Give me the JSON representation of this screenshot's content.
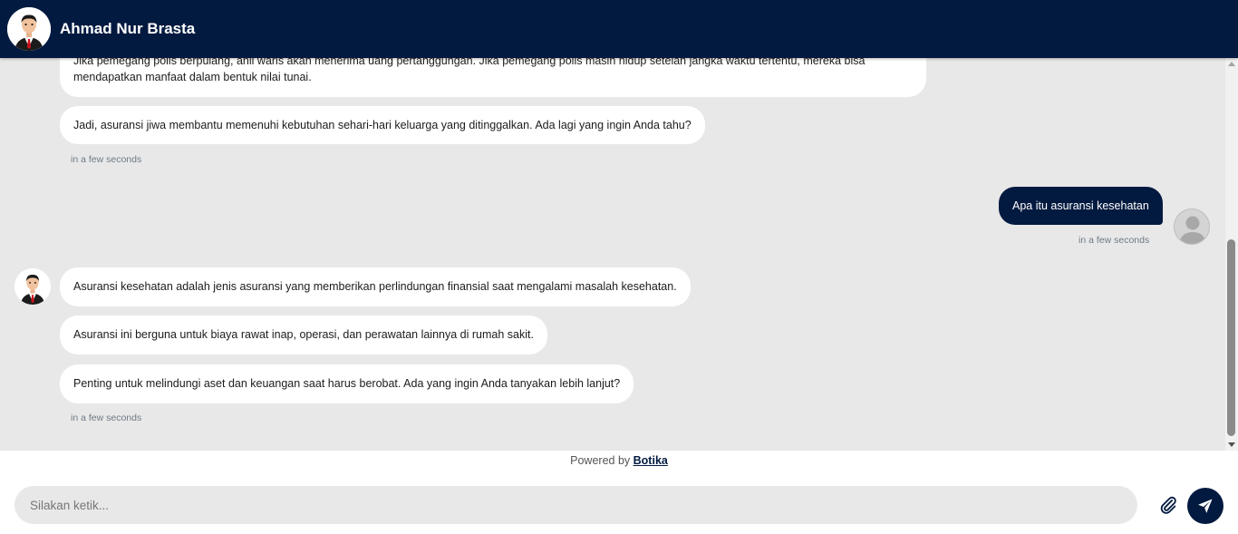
{
  "header": {
    "title": "Ahmad Nur Brasta",
    "avatar_icon": "businessman-avatar-icon"
  },
  "messages": {
    "bot_group_1": {
      "lines": [
        "Jika pemegang polis berpulang, ahli waris akan menerima uang pertanggungan. Jika pemegang polis masih hidup setelah jangka waktu tertentu, mereka bisa",
        "mendapatkan manfaat dalam bentuk nilai tunai.",
        "Jadi, asuransi jiwa membantu memenuhi kebutuhan sehari-hari keluarga yang ditinggalkan. Ada lagi yang ingin Anda tahu?"
      ],
      "timestamp": "in a few seconds"
    },
    "user_1": {
      "text": "Apa itu asuransi kesehatan",
      "timestamp": "in a few seconds"
    },
    "bot_group_2": {
      "lines": [
        "Asuransi kesehatan adalah jenis asuransi yang memberikan perlindungan finansial saat mengalami masalah kesehatan.",
        "Asuransi ini berguna untuk biaya rawat inap, operasi, dan perawatan lainnya di rumah sakit.",
        "Penting untuk melindungi aset dan keuangan saat harus berobat. Ada yang ingin Anda tanyakan lebih lanjut?"
      ],
      "timestamp": "in a few seconds"
    }
  },
  "powered": {
    "prefix": "Powered by",
    "brand": "Botika"
  },
  "composer": {
    "placeholder": "Silakan ketik...",
    "value": "",
    "attach_icon": "paperclip-icon",
    "send_icon": "send-icon"
  },
  "colors": {
    "brand": "#031a40",
    "chat_background": "#e8e8e8",
    "bubble": "#ffffff"
  }
}
